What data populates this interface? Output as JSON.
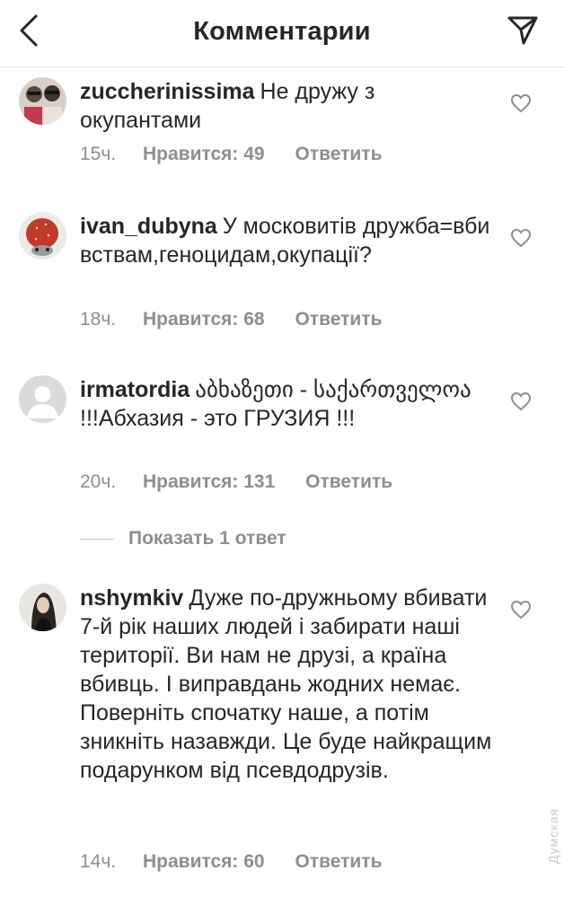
{
  "header": {
    "title": "Комментарии"
  },
  "comments": [
    {
      "username": "zuccherinissima",
      "text": "Не дружу з окупантами",
      "time": "15ч.",
      "likes": "Нравится: 49",
      "reply": "Ответить"
    },
    {
      "username": "ivan_dubyna",
      "text": "У московитів дружба=вбивствам,геноцидам,окупації?",
      "time": "18ч.",
      "likes": "Нравится: 68",
      "reply": "Ответить"
    },
    {
      "username": "irmatordia",
      "text": "აბხაზეთი - საქართველოა !!!Абхазия - это ГРУЗИЯ !!!",
      "time": "20ч.",
      "likes": "Нравится: 131",
      "reply": "Ответить",
      "show_replies": "Показать 1 ответ"
    },
    {
      "username": "nshymkiv",
      "text": "Дуже по-дружньому вбивати 7-й рік наших людей і забирати наші території. Ви нам не друзі, а країна вбивць. І виправдань жодних немає. Поверніть спочатку наше, а потім зникніть назавжди. Це буде найкращим подарунком від псевдодрузів.",
      "time": "14ч.",
      "likes": "Нравится: 60",
      "reply": "Ответить"
    }
  ],
  "watermark": "Думская",
  "colors": {
    "text": "#262626",
    "secondary": "#8e8e8e",
    "divider": "#e6e6e6"
  }
}
